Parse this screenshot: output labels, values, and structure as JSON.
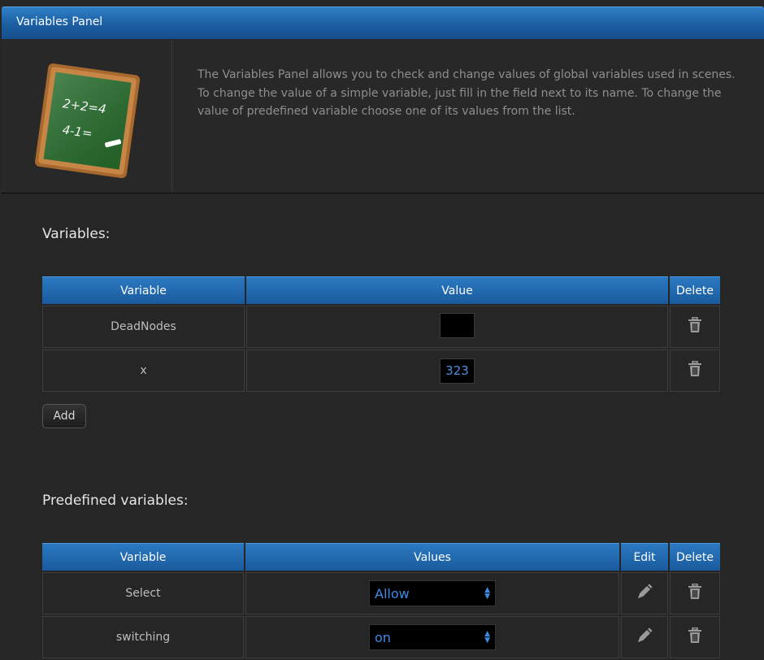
{
  "header": {
    "title": "Variables Panel"
  },
  "intro": {
    "text": "The Variables Panel allows you to check and change values of global variables used in scenes. To change the value of a simple variable, just fill in the field next to its name. To change the value of predefined variable choose one of its values from the list.",
    "chalkboard_line1": "2+2=4",
    "chalkboard_line2": "4-1="
  },
  "variables": {
    "title": "Variables:",
    "columns": {
      "variable": "Variable",
      "value": "Value",
      "delete": "Delete"
    },
    "rows": [
      {
        "name": "DeadNodes",
        "value": ""
      },
      {
        "name": "x",
        "value": "323"
      }
    ],
    "add_label": "Add"
  },
  "predefined": {
    "title": "Predefined variables:",
    "columns": {
      "variable": "Variable",
      "values": "Values",
      "edit": "Edit",
      "delete": "Delete"
    },
    "rows": [
      {
        "name": "Select",
        "selected": "Allow"
      },
      {
        "name": "switching",
        "selected": "on"
      }
    ]
  },
  "icons": {
    "delete": "trash-icon",
    "edit": "pencil-icon",
    "select": "updown-arrows-icon"
  },
  "colors": {
    "header_blue": "#1b5ea1",
    "value_text": "#4d8fe0",
    "background": "#262626"
  }
}
